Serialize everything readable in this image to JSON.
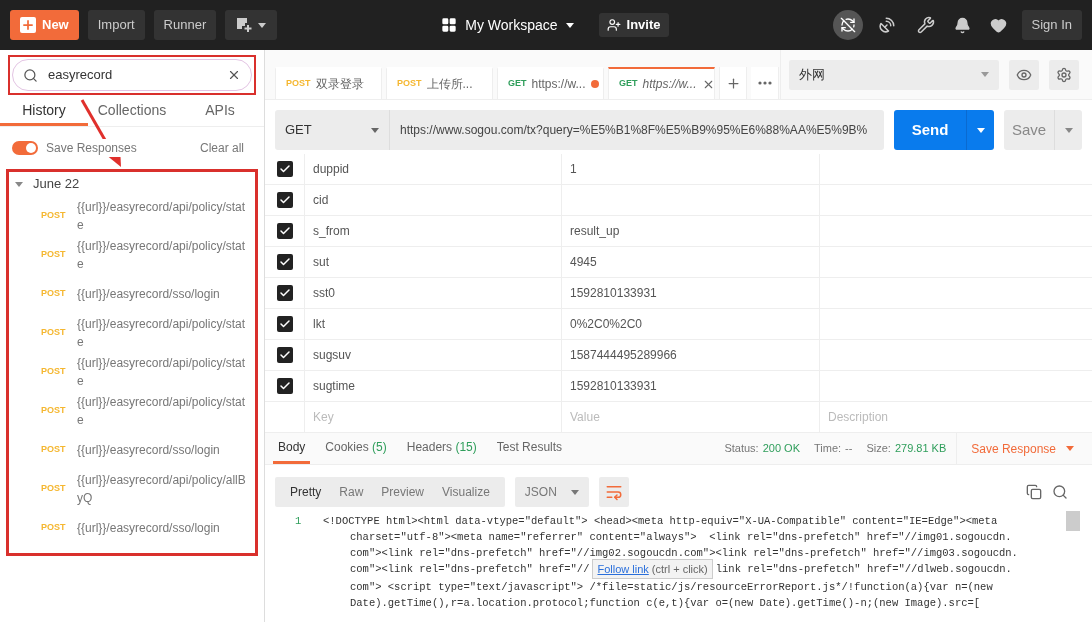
{
  "toolbar": {
    "new": "New",
    "import": "Import",
    "runner": "Runner",
    "workspace": "My Workspace",
    "invite": "Invite",
    "sign_in": "Sign In"
  },
  "sidebar": {
    "search": {
      "value": "easyrecord"
    },
    "tabs": [
      {
        "label": "History",
        "selected": true
      },
      {
        "label": "Collections",
        "selected": false
      },
      {
        "label": "APIs",
        "selected": false
      }
    ],
    "save_responses": {
      "label": "Save Responses",
      "on": true
    },
    "clear_all": "Clear all",
    "group": {
      "label": "June 22",
      "expanded": true,
      "items": [
        {
          "method": "POST",
          "color": "#f5b730",
          "url": "{{url}}/easyrecord/api/policy/state"
        },
        {
          "method": "POST",
          "color": "#f5b730",
          "url": "{{url}}/easyrecord/api/policy/state"
        },
        {
          "method": "POST",
          "color": "#f5b730",
          "url": "{{url}}/easyrecord/sso/login"
        },
        {
          "method": "POST",
          "color": "#f5b730",
          "url": "{{url}}/easyrecord/api/policy/state"
        },
        {
          "method": "POST",
          "color": "#f5b730",
          "url": "{{url}}/easyrecord/api/policy/state"
        },
        {
          "method": "POST",
          "color": "#f5b730",
          "url": "{{url}}/easyrecord/api/policy/state"
        },
        {
          "method": "POST",
          "color": "#f5b730",
          "url": "{{url}}/easyrecord/sso/login"
        },
        {
          "method": "POST",
          "color": "#f5b730",
          "url": "{{url}}/easyrecord/api/policy/allByQ"
        },
        {
          "method": "POST",
          "color": "#f5b730",
          "url": "{{url}}/easyrecord/sso/login"
        }
      ]
    }
  },
  "request_tabs": [
    {
      "method": "POST",
      "color": "#f5b730",
      "title": "双录登录",
      "selected": false,
      "unsaved": false
    },
    {
      "method": "POST",
      "color": "#f5b730",
      "title": "上传所...",
      "selected": false,
      "unsaved": false
    },
    {
      "method": "GET",
      "color": "#2f9e5b",
      "title": "https://w...",
      "selected": false,
      "unsaved": true
    },
    {
      "method": "GET",
      "color": "#2f9e5b",
      "title": "https://w...",
      "selected": true,
      "unsaved": false
    }
  ],
  "environment": "外网",
  "request": {
    "method": "GET",
    "url": "https://www.sogou.com/tx?query=%E5%B1%8F%E5%B9%95%E6%88%AA%E5%9B%",
    "send": "Send",
    "save": "Save"
  },
  "params": {
    "rows": [
      {
        "checked": true,
        "key": "duppid",
        "value": "1"
      },
      {
        "checked": true,
        "key": "cid"
      },
      {
        "checked": true,
        "key": "s_from",
        "value": "result_up"
      },
      {
        "checked": true,
        "key": "sut",
        "value": "4945"
      },
      {
        "checked": true,
        "key": "sst0",
        "value": "1592810133931"
      },
      {
        "checked": true,
        "key": "lkt",
        "value": "0%2C0%2C0"
      },
      {
        "checked": true,
        "key": "sugsuv",
        "value": "1587444495289966"
      },
      {
        "checked": true,
        "key": "sugtime",
        "value": "1592810133931"
      }
    ],
    "placeholders": {
      "key": "Key",
      "value": "Value",
      "description": "Description"
    }
  },
  "response": {
    "tabs": [
      {
        "label": "Body",
        "selected": true
      },
      {
        "label": "Cookies",
        "count": "(5)",
        "selected": false
      },
      {
        "label": "Headers",
        "count": "(15)",
        "selected": false
      },
      {
        "label": "Test Results",
        "selected": false
      }
    ],
    "status_label": "Status:",
    "status": "200 OK",
    "time_label": "Time:",
    "time": "--",
    "size_label": "Size:",
    "size": "279.81 KB",
    "save_response": "Save Response",
    "views": [
      {
        "label": "Pretty",
        "selected": true
      },
      {
        "label": "Raw",
        "selected": false
      },
      {
        "label": "Preview",
        "selected": false
      },
      {
        "label": "Visualize",
        "selected": false
      }
    ],
    "format": "JSON",
    "line_number": "1",
    "lines": [
      {
        "text": "<!DOCTYPE html><html data-vtype=\"default\"> <head><meta http-equiv=\"X-UA-Compatible\" content=\"IE=Edge\"><meta"
      },
      {
        "text": "charset=\"utf-8\"><meta name=\"referrer\" content=\"always\">  <link rel=\"dns-prefetch\" href=\"//img01.sogoucdn."
      },
      {
        "text": "com\"><link rel=\"dns-prefetch\" href=\"//img02.sogoucdn.com\"><link rel=\"dns-prefetch\" href=\"//img03.sogoucdn."
      },
      {
        "text": "com\"><link rel=\"dns-prefetch\" href=\"//",
        "text_after": "link rel=\"dns-prefetch\" href=\"//dlweb.sogoucdn."
      },
      {
        "text": "com\"> <script type=\"text/javascript\"> /*file=static/js/resourceErrorReport.js*/!function(a){var n=(new"
      },
      {
        "text": "Date).getTime(),r=a.location.protocol;function c(e,t){var o=(new Date).getTime()-n;(new Image).src=["
      }
    ],
    "tooltip": {
      "link": "Follow link",
      "hint": "(ctrl + click)"
    }
  }
}
